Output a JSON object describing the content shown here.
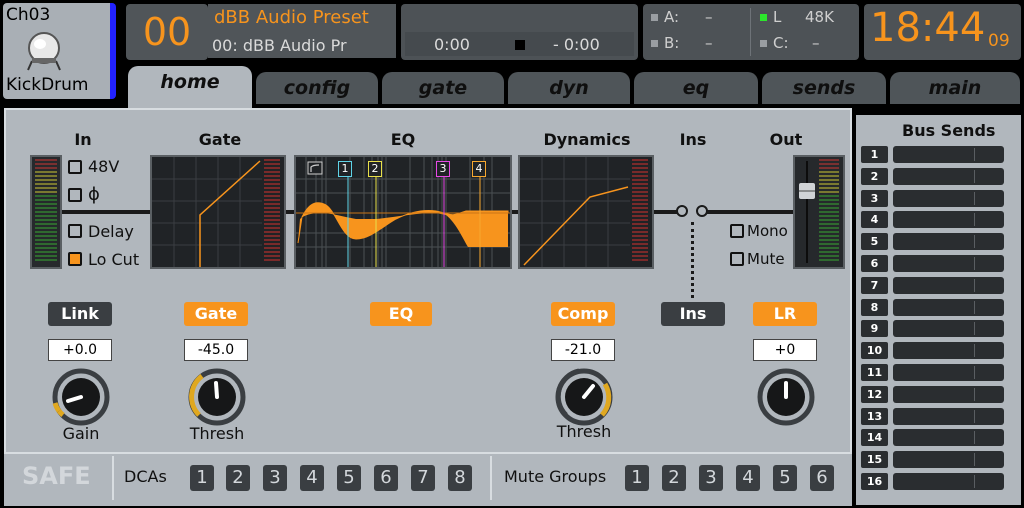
{
  "channel": {
    "id": "Ch03",
    "name": "KickDrum",
    "icon": "kick-drum-icon"
  },
  "scene": {
    "number": "00",
    "title": "dBB Audio Preset",
    "subtitle": "00: dBB Audio Pr"
  },
  "tape": {
    "time_left": "0:00",
    "time_right": "- 0:00"
  },
  "io": {
    "a_label": "A:",
    "a_value": "–",
    "b_label": "B:",
    "b_value": "–",
    "l_label": "L",
    "l_value": "48K",
    "c_label": "C:",
    "c_value": "–"
  },
  "clock": {
    "time": "18:44",
    "seconds": "09"
  },
  "tabs": [
    {
      "label": "home",
      "active": true
    },
    {
      "label": "config"
    },
    {
      "label": "gate"
    },
    {
      "label": "dyn"
    },
    {
      "label": "eq"
    },
    {
      "label": "sends"
    },
    {
      "label": "main"
    }
  ],
  "sections": {
    "in": "In",
    "gate": "Gate",
    "eq": "EQ",
    "dynamics": "Dynamics",
    "ins": "Ins",
    "out": "Out"
  },
  "input_options": {
    "phantom": "48V",
    "phase": "ϕ",
    "delay": "Delay",
    "lo_cut": "Lo Cut"
  },
  "output_options": {
    "mono": "Mono",
    "mute": "Mute"
  },
  "eq_bands": [
    "1",
    "2",
    "3",
    "4"
  ],
  "buttons": {
    "link": "Link",
    "gate": "Gate",
    "eq": "EQ",
    "comp": "Comp",
    "ins": "Ins",
    "lr": "LR"
  },
  "values": {
    "gain": "+0.0",
    "gate_thresh": "-45.0",
    "comp_thresh": "-21.0",
    "lr": "+0"
  },
  "knobs": {
    "gain": "Gain",
    "gate_thresh": "Thresh",
    "comp_thresh": "Thresh"
  },
  "bus_sends": {
    "title": "Bus Sends",
    "buses": [
      "1",
      "2",
      "3",
      "4",
      "5",
      "6",
      "7",
      "8",
      "9",
      "10",
      "11",
      "12",
      "13",
      "14",
      "15",
      "16"
    ]
  },
  "bottom": {
    "safe": "SAFE",
    "dcas_label": "DCAs",
    "dcas": [
      "1",
      "2",
      "3",
      "4",
      "5",
      "6",
      "7",
      "8"
    ],
    "mute_groups_label": "Mute Groups",
    "mute_groups": [
      "1",
      "2",
      "3",
      "4",
      "5",
      "6"
    ]
  },
  "colors": {
    "accent": "#f7941d",
    "panel": "#b1b7bd",
    "dark": "#3a3e42",
    "selection": "#2222ff"
  }
}
